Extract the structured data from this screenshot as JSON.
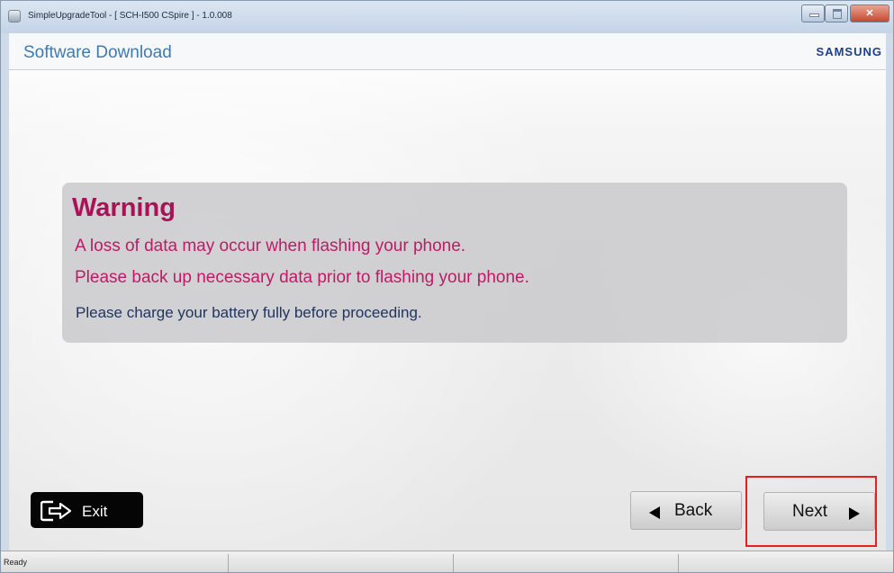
{
  "window": {
    "title": "SimpleUpgradeTool - [ SCH-I500 CSpire ] - 1.0.008",
    "controls": {
      "minimize": "–",
      "maximize": "□",
      "close": "✕"
    }
  },
  "header": {
    "title": "Software Download",
    "logo": "SAMSUNG"
  },
  "warning": {
    "title": "Warning",
    "line1": "A loss of data may occur when flashing your phone.",
    "line2": "Please back up necessary data prior to flashing your phone.",
    "note": "Please charge your battery fully before proceeding.",
    "title_color": "#aa1257",
    "text_color": "#c01a66",
    "note_color": "#20345e"
  },
  "buttons": {
    "exit_label": "Exit",
    "exit_icon": "exit-arrow-icon",
    "back_label": "Back",
    "back_icon": "triangle-left-icon",
    "next_label": "Next",
    "next_icon": "triangle-right-icon"
  },
  "highlight": {
    "target": "next-button",
    "color": "#e8201a"
  },
  "statusbar": {
    "text": "Ready"
  },
  "colors": {
    "accent": "#3f7ab1",
    "brand": "#1b3f90"
  }
}
